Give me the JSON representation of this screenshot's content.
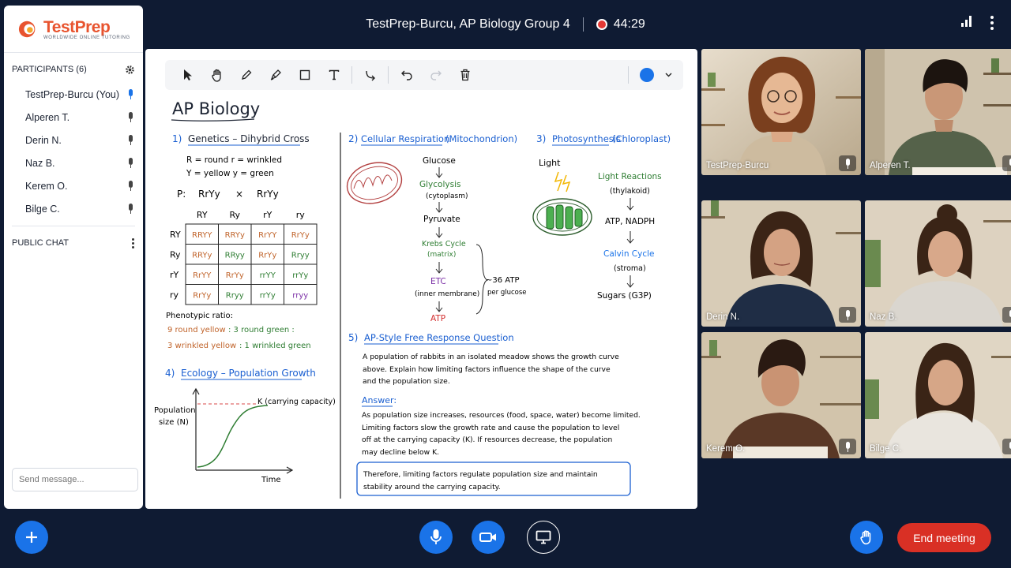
{
  "meeting": {
    "title": "TestPrep-Burcu, AP Biology Group 4",
    "timer": "44:29"
  },
  "brand": {
    "name": "TestPrep",
    "tagline": "WORLDWIDE ONLINE TUTORING",
    "accent": "#e8542f"
  },
  "participants": {
    "header": "PARTICIPANTS (6)",
    "list": [
      {
        "name": "TestPrep-Burcu (You)",
        "mic_active": true
      },
      {
        "name": "Alperen T.",
        "mic_active": false
      },
      {
        "name": "Derin N.",
        "mic_active": false
      },
      {
        "name": "Naz B.",
        "mic_active": false
      },
      {
        "name": "Kerem O.",
        "mic_active": false
      },
      {
        "name": "Bilge C.",
        "mic_active": false
      }
    ]
  },
  "chat": {
    "header": "PUBLIC CHAT",
    "placeholder": "Send message..."
  },
  "whiteboard": {
    "title": "AP Biology",
    "pen_color": "#1a73e8",
    "genetics": {
      "heading_num": "1)",
      "heading": "Genetics – Dihybrid Cross",
      "key1": "R = round    r = wrinkled",
      "key2": "Y = yellow    y = green",
      "cross_p": "P:",
      "cross_a": "RrYy",
      "cross_x": "×",
      "cross_b": "RrYy",
      "col_headers": [
        "RY",
        "Ry",
        "rY",
        "ry"
      ],
      "row_headers": [
        "RY",
        "Ry",
        "rY",
        "ry"
      ],
      "cells": [
        [
          "RRYY",
          "RRYy",
          "RrYY",
          "RrYy"
        ],
        [
          "RRYy",
          "RRyy",
          "RrYy",
          "Rryy"
        ],
        [
          "RrYY",
          "RrYy",
          "rrYY",
          "rrYy"
        ],
        [
          "RrYy",
          "Rryy",
          "rrYy",
          "rryy"
        ]
      ],
      "ratio_label": "Phenotypic ratio:",
      "ratio_line1_a": "9 round yellow",
      "ratio_line1_b": ": 3 round green :",
      "ratio_line2_a": "3 wrinkled yellow",
      "ratio_line2_b": ": 1 wrinkled green"
    },
    "respiration": {
      "heading_num": "2)",
      "heading": "Cellular Respiration",
      "heading_suffix": "(Mitochondrion)",
      "steps": [
        "Glucose",
        "Glycolysis",
        "(cytoplasm)",
        "Pyruvate",
        "Krebs Cycle",
        "(matrix)",
        "ETC",
        "(inner membrane)",
        "ATP"
      ],
      "atp_note1": "~36 ATP",
      "atp_note2": "per glucose"
    },
    "photosynthesis": {
      "heading_num": "3)",
      "heading": "Photosynthesis",
      "heading_suffix": "(Chloroplast)",
      "light": "Light",
      "steps": [
        "Light Reactions",
        "(thylakoid)",
        "ATP, NADPH",
        "Calvin Cycle",
        "(stroma)",
        "Sugars (G3P)"
      ]
    },
    "ecology": {
      "heading_num": "4)",
      "heading": "Ecology – Population Growth",
      "ylabel1": "Population",
      "ylabel2": "size (N)",
      "xlabel": "Time",
      "k_label": "K (carrying capacity)"
    },
    "frq": {
      "heading_num": "5)",
      "heading": "AP-Style Free Response Question",
      "q1": "A population of rabbits in an isolated meadow shows the growth curve",
      "q2": "above. Explain how limiting factors influence the shape of the curve",
      "q3": "and the population size.",
      "answer_label": "Answer:",
      "a1": "As population size increases, resources (food, space, water) become limited.",
      "a2": "Limiting factors slow the growth rate and cause the population to level",
      "a3": "off at the carrying capacity (K). If resources decrease, the population",
      "a4": "may decline below K.",
      "c1": "Therefore, limiting factors regulate population size and maintain",
      "c2": "stability around the carrying capacity."
    }
  },
  "video_tiles": [
    {
      "name": "TestPrep-Burcu"
    },
    {
      "name": "Alperen T."
    },
    {
      "name": "Derin N."
    },
    {
      "name": "Naz B."
    },
    {
      "name": "Kerem O."
    },
    {
      "name": "Bilge C."
    }
  ],
  "controls": {
    "end_label": "End meeting",
    "end_color": "#d93025",
    "primary_color": "#1a73e8"
  }
}
